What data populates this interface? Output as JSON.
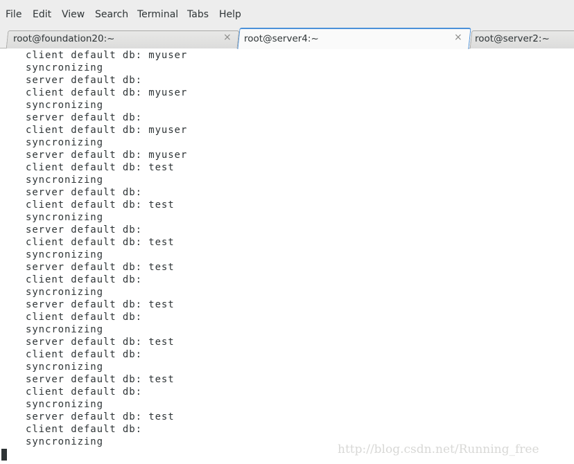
{
  "menubar": {
    "items": [
      "File",
      "Edit",
      "View",
      "Search",
      "Terminal",
      "Tabs",
      "Help"
    ]
  },
  "tabs": [
    {
      "label": "root@foundation20:~",
      "active": false,
      "close": "×"
    },
    {
      "label": "root@server4:~",
      "active": true,
      "close": "×"
    },
    {
      "label": "root@server2:~",
      "active": false
    }
  ],
  "terminal": {
    "lines": [
      "client default db: myuser",
      "syncronizing",
      "server default db:",
      "client default db: myuser",
      "syncronizing",
      "server default db:",
      "client default db: myuser",
      "syncronizing",
      "server default db: myuser",
      "client default db: test",
      "syncronizing",
      "server default db:",
      "client default db: test",
      "syncronizing",
      "server default db:",
      "client default db: test",
      "syncronizing",
      "server default db: test",
      "client default db:",
      "syncronizing",
      "server default db: test",
      "client default db:",
      "syncronizing",
      "server default db: test",
      "client default db:",
      "syncronizing",
      "server default db: test",
      "client default db:",
      "syncronizing",
      "server default db: test",
      "client default db:",
      "syncronizing"
    ]
  },
  "watermark": "http://blog.csdn.net/Running_free",
  "colors": {
    "active_tab_accent": "#4a90d9",
    "text": "#2e3436",
    "chrome_bg": "#ededed"
  }
}
